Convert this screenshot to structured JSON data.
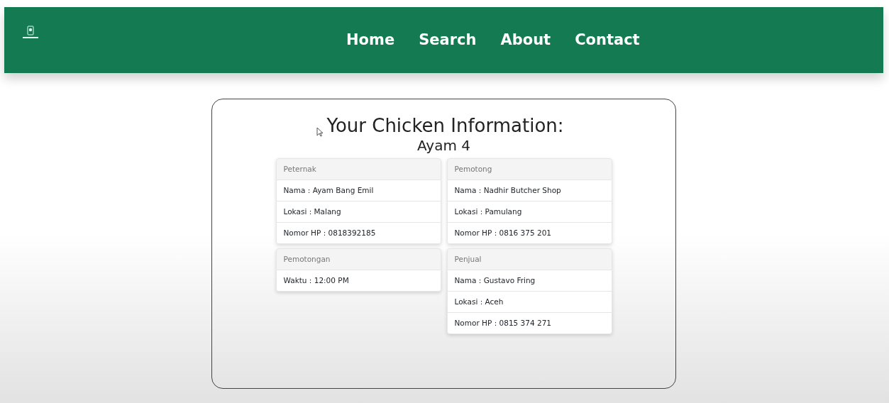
{
  "navbar": {
    "links": [
      {
        "label": "Home"
      },
      {
        "label": "Search"
      },
      {
        "label": "About"
      },
      {
        "label": "Contact"
      }
    ]
  },
  "info": {
    "title": "Your Chicken Information:",
    "subtitle": "Ayam 4",
    "columns": [
      [
        {
          "header": "Peternak",
          "items": [
            "Nama : Ayam Bang Emil",
            "Lokasi : Malang",
            "Nomor HP : 0818392185"
          ]
        },
        {
          "header": "Pemotongan",
          "items": [
            "Waktu : 12:00 PM"
          ]
        }
      ],
      [
        {
          "header": "Pemotong",
          "items": [
            "Nama : Nadhir Butcher Shop",
            "Lokasi : Pamulang",
            "Nomor HP : 0816 375 201"
          ]
        },
        {
          "header": "Penjual",
          "items": [
            "Nama : Gustavo Fring",
            "Lokasi : Aceh",
            "Nomor HP : 0815 374 271"
          ]
        }
      ]
    ]
  }
}
